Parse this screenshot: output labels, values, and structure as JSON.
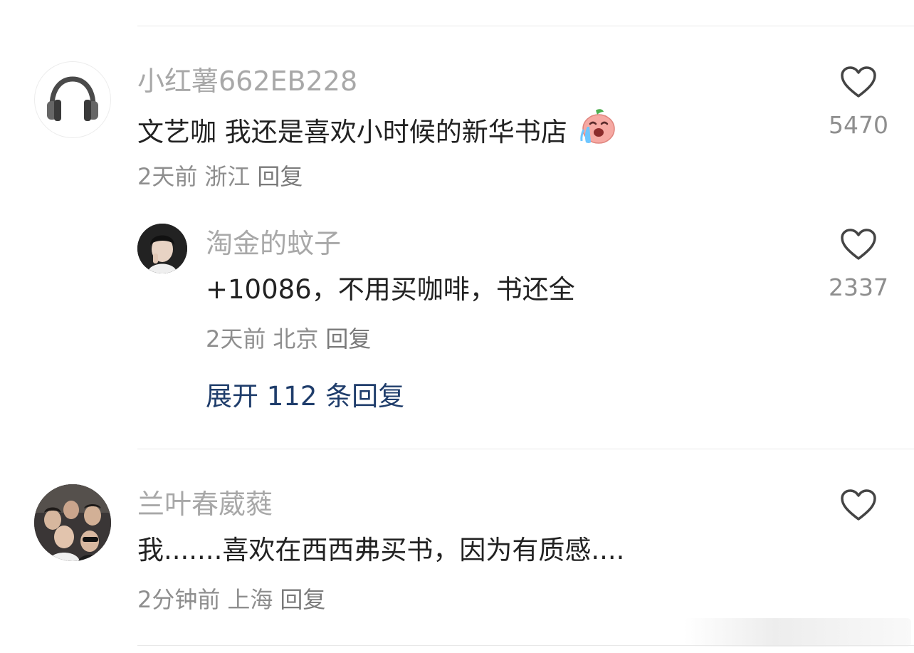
{
  "comments": [
    {
      "username": "小红薯662EB228",
      "text": "文艺咖 我还是喜欢小时候的新华书店",
      "emoji": "crying-peach-emoji",
      "time": "2天前",
      "location": "浙江",
      "reply_label": "回复",
      "likes": "5470",
      "avatar": "headphones-icon"
    },
    {
      "username": "淘金的蚊子",
      "text": "+10086，不用买咖啡，书还全",
      "time": "2天前",
      "location": "北京",
      "reply_label": "回复",
      "likes": "2337",
      "avatar": "user-photo-avatar"
    },
    {
      "username": "兰叶春葳蕤",
      "text": "我.......喜欢在西西弗买书，因为有质感....",
      "time": "2分钟前",
      "location": "上海",
      "reply_label": "回复",
      "likes": "",
      "avatar": "group-photo-avatar"
    }
  ],
  "expand_replies": "展开 112 条回复",
  "colors": {
    "username": "#a8a8a8",
    "text": "#222222",
    "meta": "#8e8e8e",
    "expand_link": "#1f3d6b",
    "divider": "#e8e8e8"
  }
}
